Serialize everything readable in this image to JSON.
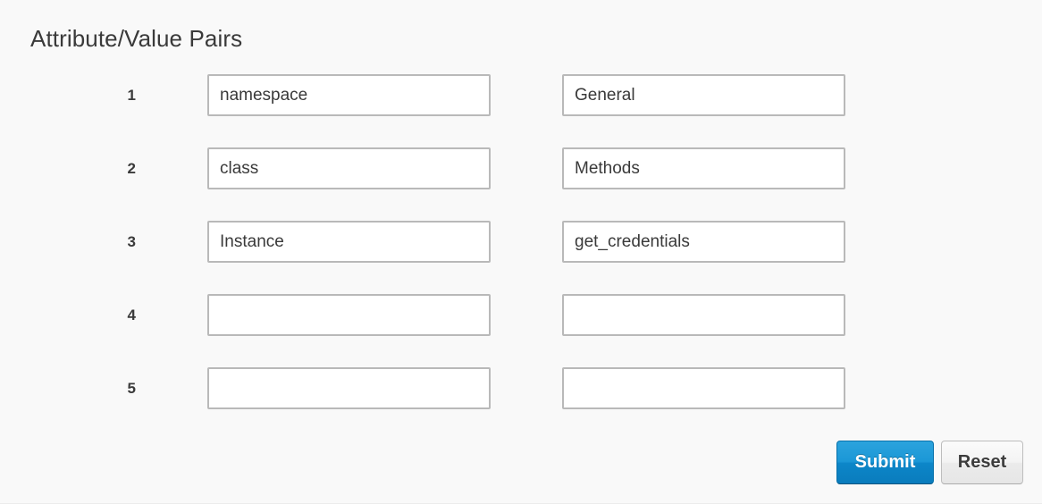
{
  "page": {
    "title": "Attribute/Value Pairs",
    "background_color": "#f9f9f9",
    "text_color": "#3a3a3a"
  },
  "form": {
    "rows": [
      {
        "index": "1",
        "attribute": "namespace",
        "value": "General",
        "attribute_placeholder": "",
        "value_placeholder": ""
      },
      {
        "index": "2",
        "attribute": "class",
        "value": "Methods",
        "attribute_placeholder": "",
        "value_placeholder": ""
      },
      {
        "index": "3",
        "attribute": "Instance",
        "value": "get_credentials",
        "attribute_placeholder": "",
        "value_placeholder": ""
      },
      {
        "index": "4",
        "attribute": "",
        "value": "",
        "attribute_placeholder": "",
        "value_placeholder": ""
      },
      {
        "index": "5",
        "attribute": "",
        "value": "",
        "attribute_placeholder": "",
        "value_placeholder": ""
      }
    ]
  },
  "actions": {
    "submit_label": "Submit",
    "reset_label": "Reset",
    "submit_color": "#1b97d6",
    "reset_color": "#f0f0f0"
  }
}
